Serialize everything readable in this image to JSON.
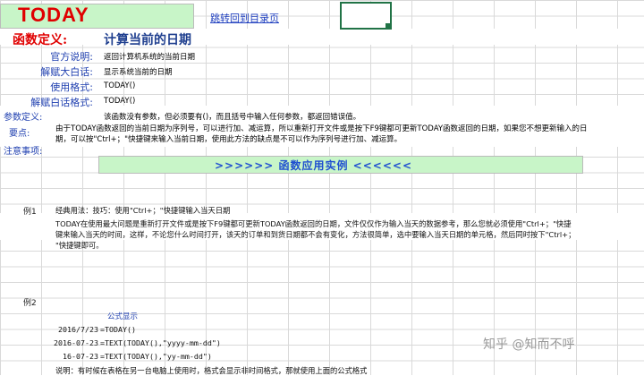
{
  "header": {
    "title": "TODAY",
    "jump_link": "跳转回到目录页"
  },
  "definition": {
    "label": "函数定义:",
    "value": "计算当前的日期"
  },
  "fields": [
    {
      "label": "官方说明:",
      "value": "返回计算机系统的当前日期"
    },
    {
      "label": "解赋大白话:",
      "value": "显示系统当前的日期"
    },
    {
      "label": "使用格式:",
      "value": "TODAY()"
    },
    {
      "label": "解赋白话格式:",
      "value": "TODAY()"
    }
  ],
  "params": {
    "label": "参数定义:",
    "value": "该函数没有参数，但必须要有()，而且括号中输入任何参数，都返回错误值。"
  },
  "points": {
    "label": "要点:",
    "line1": "由于TODAY函数返回的当前日期为序列号，可以进行加、减运算，所以重新打开文件或是按下F9键都可更新TODAY函数返回的日期，如果您不想更新输入的日",
    "line2": "期，可以按\"Ctrl+；\"快捷键来输入当前日期，使用此方法的缺点是不可以作为序列号进行加、减运算。"
  },
  "notes": {
    "label": "注意事项:"
  },
  "banner": {
    "text": ">>>>>>  函数应用实例  <<<<<<"
  },
  "example1": {
    "label": "例1",
    "title": "经典用法：技巧：使用\"Ctrl+；\"快捷键输入当天日期",
    "line1": "TODAY在使用最大问题是重新打开文件或是按下F9键都可更新TODAY函数返回的日期，文件仅仅作为输入当天的数据参考，那么您就必须使用\"Ctrl+；\"快捷",
    "line2": "键来输入当天的时间，这样，不论您什么时间打开，该天的订单和到货日期都不会有变化，方法很简单，选中要输入当天日期的单元格，然后同时按下\"Ctrl+；",
    "line3": "\"快捷键即可。"
  },
  "example2": {
    "label": "例2",
    "formula_header": "公式显示",
    "rows": [
      {
        "result": "2016/7/23",
        "formula": "=TODAY()"
      },
      {
        "result": "2016-07-23",
        "formula": "=TEXT(TODAY(),\"yyyy-mm-dd\")"
      },
      {
        "result": "16-07-23",
        "formula": "=TEXT(TODAY(),\"yy-mm-dd\")"
      }
    ],
    "note": "说明：有时候在表格在另一台电脑上使用时，格式会显示非时间格式，那就使用上面的公式格式"
  },
  "watermark": "知乎 @知而不呼"
}
